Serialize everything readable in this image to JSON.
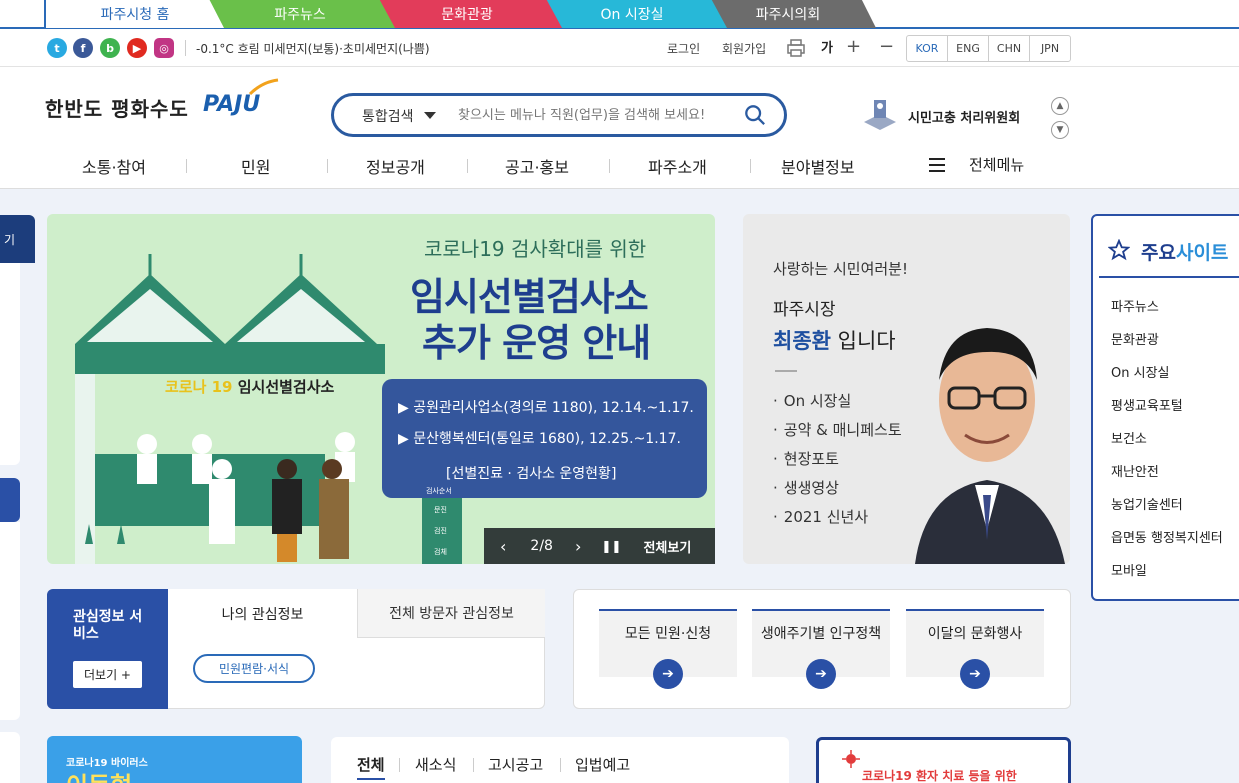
{
  "top_tabs": [
    "파주시청 홈",
    "파주뉴스",
    "문화관광",
    "On 시장실",
    "파주시의회"
  ],
  "util": {
    "sns": [
      "t",
      "f",
      "b",
      "▶",
      "◎"
    ],
    "weather": "-0.1°C 흐림 미세먼지(보통)·초미세먼지(나쁨)",
    "login": "로그인",
    "join": "회원가입",
    "font_label": "가",
    "font_plus": "+",
    "font_minus": "−",
    "langs": [
      "KOR",
      "ENG",
      "CHN",
      "JPN"
    ]
  },
  "header": {
    "logo_text": "한반도 평화수도",
    "logo_brand": "PAJU",
    "search_scope": "통합검색",
    "search_placeholder": "찾으시는 메뉴나 직원(업무)을 검색해 보세요!",
    "grievance": "시민고충 처리위원회"
  },
  "gnb": [
    "소통·참여",
    "민원",
    "정보공개",
    "공고·홍보",
    "파주소개",
    "분야별정보"
  ],
  "all_menu": "전체메뉴",
  "left_tab": "기",
  "banner": {
    "subtitle": "코로나19 검사확대를 위한",
    "title1": "임시선별검사소",
    "title2": "추가 운영 안내",
    "label_prefix": "코로나 19",
    "label": "임시선별검사소",
    "line1": "▶ 공원관리사업소(경의로 1180),  12.14.~1.17.",
    "line2": "▶ 문산행복센터(통일로 1680),  12.25.~1.17.",
    "line3": "[선별진료 · 검사소 운영현황]",
    "booth_labels": [
      "검사순서",
      "문진",
      "검진",
      "검체"
    ],
    "counter": "2/8",
    "view_all": "전체보기"
  },
  "greeting": {
    "line1": "사랑하는 시민여러분!",
    "line2": "파주시장",
    "name": "최종환",
    "suffix": " 입니다",
    "links": [
      "On 시장실",
      "공약 & 매니페스토",
      "현장포토",
      "생생영상",
      "2021 신년사"
    ]
  },
  "sites": {
    "title_a": "주요",
    "title_b": "사이트",
    "items": [
      "파주뉴스",
      "문화관광",
      "On 시장실",
      "평생교육포털",
      "보건소",
      "재난안전",
      "농업기술센터",
      "읍면동 행정복지센터",
      "모바일"
    ]
  },
  "interest": {
    "title": "관심정보 서비스",
    "more": "더보기  +",
    "tab_mine": "나의 관심정보",
    "tab_all": "전체 방문자 관심정보",
    "pill": "민원편람·서식"
  },
  "quick": [
    "모든 민원·신청",
    "생애주기별 인구정책",
    "이달의 문화행사"
  ],
  "covid": {
    "small": "코로나19 바이러스",
    "big": "이동형"
  },
  "news_tabs": [
    "전체",
    "새소식",
    "고시공고",
    "입법예고"
  ],
  "notice": "코로나19 환자 치료 등을 위한",
  "colors": {
    "primary": "#2a50a6",
    "dark": "#1e3e8e",
    "green_tab": "#6ac04a",
    "red_tab": "#e23c5a",
    "cyan_tab": "#27b8d8"
  }
}
